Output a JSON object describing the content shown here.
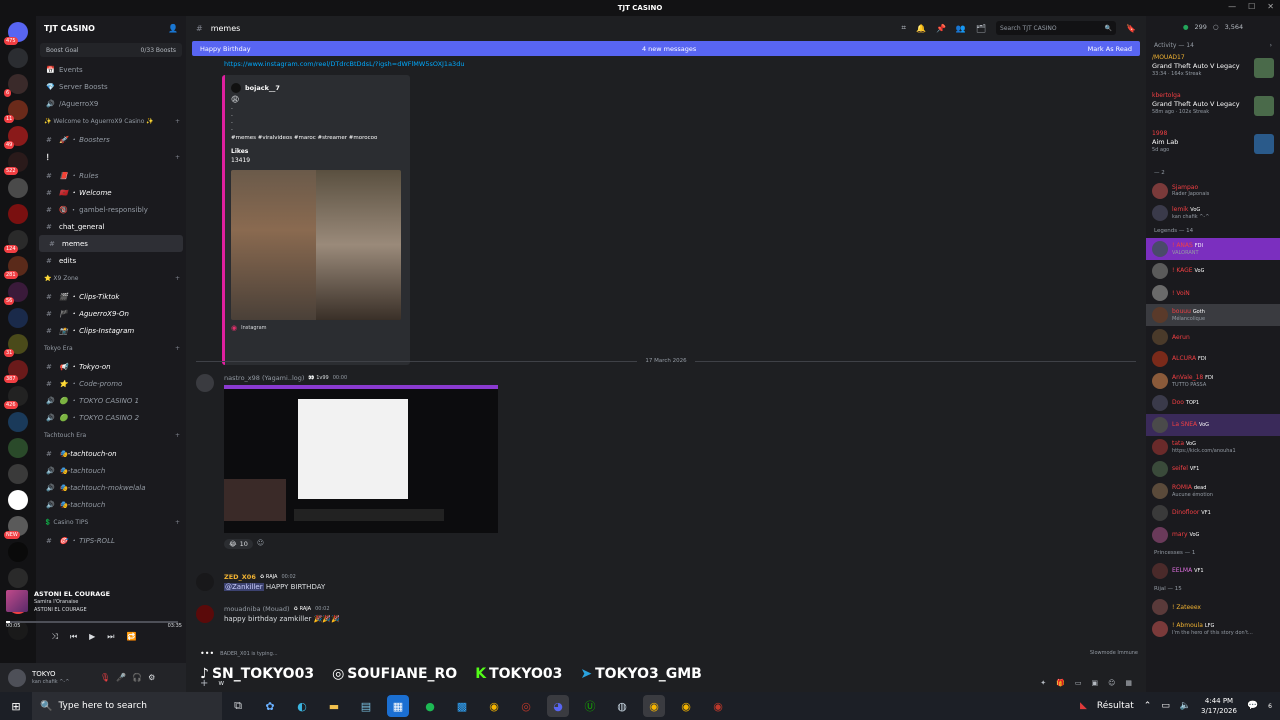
{
  "window": {
    "title": "TJT CASINO"
  },
  "server": {
    "name": "TJT CASINO",
    "boost_label": "Boost Goal",
    "boost_count": "0/33 Boosts"
  },
  "rail_badges": [
    "475",
    "",
    "6",
    "11",
    "49",
    "522",
    "",
    "",
    "124",
    "281",
    "56",
    "",
    "31",
    "387",
    "426",
    "",
    "",
    "",
    "",
    "NEW"
  ],
  "channels": [
    {
      "type": "item",
      "icon": "events",
      "label": "Events"
    },
    {
      "type": "item",
      "icon": "boost",
      "label": "Server Boosts"
    },
    {
      "type": "voice",
      "label": "/AguerroX9"
    },
    {
      "type": "cat",
      "label": "✨ Welcome to AguerroX9 Casino ✨"
    },
    {
      "type": "text",
      "label": "🚀 ・ Boosters",
      "italic": true
    },
    {
      "type": "cat",
      "label": "❕"
    },
    {
      "type": "text",
      "label": "📕 ・ Rules",
      "italic": true
    },
    {
      "type": "text",
      "label": "🇲🇦 ・ Welcome",
      "italic": true,
      "bright": true
    },
    {
      "type": "text",
      "label": "🔞 ・ gambel-responsibly"
    },
    {
      "type": "text",
      "label": "chat_general",
      "bright": true
    },
    {
      "type": "text",
      "label": "memes",
      "active": true
    },
    {
      "type": "text",
      "label": "edits",
      "bright": true
    },
    {
      "type": "cat",
      "label": "⭐ X9 Zone"
    },
    {
      "type": "text",
      "label": "🎬 ・ Clips-Tiktok",
      "italic": true,
      "bright": true
    },
    {
      "type": "text",
      "label": "🏴 ・ AguerroX9-On",
      "italic": true,
      "bright": true
    },
    {
      "type": "text",
      "label": "📸 ・ Clips-Instagram",
      "italic": true,
      "bright": true
    },
    {
      "type": "cat",
      "label": "Tokyo Era"
    },
    {
      "type": "text",
      "label": "📢 ・ Tokyo-on",
      "italic": true,
      "bright": true
    },
    {
      "type": "text",
      "label": "⭐ ・ Code-promo",
      "italic": true
    },
    {
      "type": "voice",
      "label": "🟢 ・ TOKYO CASINO 1",
      "italic": true
    },
    {
      "type": "voice",
      "label": "🟢 ・ TOKYO CASINO 2",
      "italic": true
    },
    {
      "type": "cat",
      "label": "Tachtouch Era"
    },
    {
      "type": "text",
      "label": "🎭-tachtouch-on",
      "italic": true,
      "bright": true
    },
    {
      "type": "voice",
      "label": "🎭-tachtouch",
      "italic": true
    },
    {
      "type": "voice",
      "label": "🎭-tachtouch-mokwelala",
      "italic": true
    },
    {
      "type": "voice",
      "label": "🎭-tachtouch",
      "italic": true
    },
    {
      "type": "cat",
      "label": "💲 Casino TIPS"
    },
    {
      "type": "text",
      "label": "🎯 ・ TIPS-ROLL",
      "italic": true
    }
  ],
  "now_playing": {
    "title": "ASTONI EL COURAGE",
    "artist": "Samira l'Oranaise",
    "album": "ASTONI EL COURAGE",
    "elapsed": "00:05",
    "total": "03:35",
    "progress": 0.023
  },
  "user": {
    "name": "TOKYO",
    "status": "kan chafik ^-^"
  },
  "channel": {
    "name": "memes"
  },
  "search": {
    "placeholder": "Search TJT CASINO"
  },
  "banner": {
    "event": "Happy Birthday",
    "new_messages": "4 new messages",
    "mark_read": "Mark As Read"
  },
  "embed": {
    "link": "https://www.instagram.com/reel/DTdrcBtDdsL/?igsh=dWFlMW5sOXJ1a3du",
    "author": "bojack__7",
    "emoji": "😩",
    "dots": [
      ".",
      ".",
      ".",
      "."
    ],
    "tags": "#memes #viralvideos #maroc #streamer #morocoo",
    "likes_label": "Likes",
    "likes": "13419",
    "footer": "Instagram"
  },
  "date_divider": "17 March 2026",
  "messages": [
    {
      "name": "nastro_x98 (Yagami..log)",
      "badge": "👀 1v99",
      "time": "00:00",
      "color": "#949ba4"
    },
    {
      "name": "ZED_X06",
      "badge": "♻ RAJA",
      "time": "00:02",
      "color": "#f0b232",
      "mention": "@Zankiller",
      "text": "HAPPY BIRTHDAY"
    },
    {
      "name": "mouadniba (Mouad)",
      "badge": "♻ RAJA",
      "time": "00:02",
      "color": "#949ba4",
      "text": "happy birthday zamkiller",
      "emoji": "🎉🎉🎉"
    }
  ],
  "reactions": [
    {
      "emoji": "😂",
      "count": "10"
    }
  ],
  "typing": "BADER_X01 is typing...",
  "slowmode": "Slowmode Immune",
  "composer_text": "w",
  "socials": [
    {
      "icon": "tiktok",
      "label": "SN_TOKYO03"
    },
    {
      "icon": "instagram",
      "label": "SOUFIANE_RO"
    },
    {
      "icon": "kick",
      "label": "TOKYO03"
    },
    {
      "icon": "telegram",
      "label": "TOKYO3_GMB"
    }
  ],
  "members_online": "299",
  "members_total": "3,564",
  "activity": {
    "header": "Activity — 14",
    "cards": [
      {
        "user": "/MOUAD17",
        "user_color": "#f0b232",
        "game": "Grand Theft Auto V Legacy",
        "meta": "33:34 · 164x Streak"
      },
      {
        "user": "kbertolga",
        "user_color": "#f23f43",
        "game": "Grand Theft Auto V Legacy",
        "meta": "58m ago · 102x Streak"
      },
      {
        "user": "1998",
        "user_color": "#f23f43",
        "game": "Aim Lab",
        "meta": "5d ago"
      }
    ]
  },
  "groups": [
    {
      "header": "— 2",
      "members": [
        {
          "name": "Sjampao",
          "sub": "Rader Japonais",
          "color": "#f23f43"
        },
        {
          "name": "lemik",
          "sub": "kan chafik ^-^",
          "color": "#f23f43",
          "tag": "VoG"
        }
      ]
    },
    {
      "header": "Legends — 14",
      "members": [
        {
          "name": "! ANAS",
          "sub": "VALORANT",
          "color": "#f23f43",
          "tag": "FDI",
          "hl": "#7b2fbf"
        },
        {
          "name": "! KAGE",
          "sub": "",
          "color": "#f23f43",
          "tag": "VoG"
        },
        {
          "name": "! VoiN",
          "sub": "",
          "color": "#f23f43"
        },
        {
          "name": "bouuu",
          "sub": "Mélancolique",
          "color": "#f23f43",
          "tag": "Goth",
          "hl": "#3a3b40"
        },
        {
          "name": "Aerun",
          "sub": "",
          "color": "#f23f43"
        },
        {
          "name": "ALCURA",
          "sub": "",
          "color": "#f23f43",
          "tag": "FDI"
        },
        {
          "name": "AnVale_18",
          "sub": "TUTTO PASSA",
          "color": "#f23f43",
          "tag": "FDI"
        },
        {
          "name": "Doo",
          "sub": "",
          "color": "#f23f43",
          "tag": "TOP1"
        },
        {
          "name": "La SNEA",
          "sub": "",
          "color": "#f23f43",
          "tag": "VoG",
          "hl": "#3a2a5a"
        },
        {
          "name": "tata",
          "sub": "https://kick.com/anouha1",
          "color": "#f23f43",
          "tag": "VoG"
        },
        {
          "name": "seifel",
          "sub": "",
          "color": "#f23f43",
          "tag": "VF1"
        },
        {
          "name": "ROMIA",
          "sub": "Aucune émotion",
          "color": "#f23f43",
          "tag": "dead"
        },
        {
          "name": "Dinofloor",
          "sub": "",
          "color": "#f23f43",
          "tag": "VF1"
        },
        {
          "name": "mary",
          "sub": "",
          "color": "#f23f43",
          "tag": "VoG"
        }
      ]
    },
    {
      "header": "Princesses — 1",
      "members": [
        {
          "name": "EELMA",
          "sub": "",
          "color": "#e070e0",
          "tag": "VF1"
        }
      ]
    },
    {
      "header": "Rijal — 15",
      "members": [
        {
          "name": "! Zateeex",
          "sub": "",
          "color": "#f0b232"
        },
        {
          "name": "! Abmoula",
          "sub": "I'm the hero of this story don't...",
          "color": "#f0b232",
          "tag": "LFG"
        }
      ]
    }
  ],
  "taskbar": {
    "search_placeholder": "Type here to search",
    "weather": "Résultat",
    "time": "4:44 PM",
    "date": "3/17/2026",
    "notif": "6"
  }
}
